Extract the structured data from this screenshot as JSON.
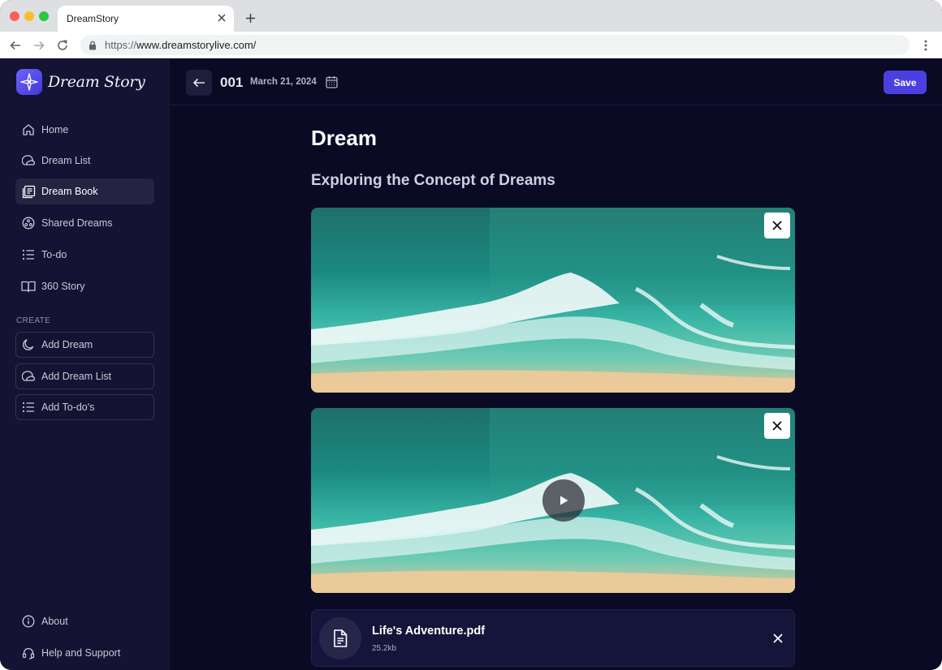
{
  "browser": {
    "tab_title": "DreamStory",
    "url_scheme": "https://",
    "url_host": "www.dreamstorylive.com/"
  },
  "app": {
    "logo_text": "Dream Story",
    "brand_color": "#4b3fe0"
  },
  "sidebar": {
    "items": [
      {
        "label": "Home",
        "icon": "home-icon"
      },
      {
        "label": "Dream List",
        "icon": "moon-cloud-icon"
      },
      {
        "label": "Dream Book",
        "icon": "book-icon"
      },
      {
        "label": "Shared Dreams",
        "icon": "share-circle-icon"
      },
      {
        "label": "To-do",
        "icon": "list-icon"
      },
      {
        "label": "360 Story",
        "icon": "open-book-icon"
      }
    ],
    "active": "Dream Book",
    "create_label": "CREATE",
    "create_items": [
      {
        "label": "Add Dream",
        "icon": "moon-icon"
      },
      {
        "label": "Add Dream List",
        "icon": "moon-cloud-icon"
      },
      {
        "label": "Add To-do's",
        "icon": "list-icon"
      }
    ],
    "footer_items": [
      {
        "label": "About",
        "icon": "info-icon"
      },
      {
        "label": "Help and Support",
        "icon": "headset-icon"
      }
    ]
  },
  "header": {
    "entry_number": "001",
    "entry_date": "March 21, 2024",
    "save_label": "Save"
  },
  "content": {
    "title": "Dream",
    "subtitle": "Exploring the Concept of Dreams",
    "media": [
      {
        "type": "image",
        "description_icon": "ocean-aerial-image"
      },
      {
        "type": "video",
        "description_icon": "ocean-aerial-video"
      }
    ],
    "file": {
      "name": "Life's Adventure.pdf",
      "size": "25.2kb"
    }
  }
}
